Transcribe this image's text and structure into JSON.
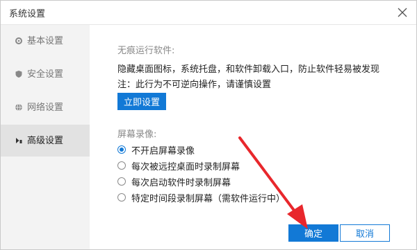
{
  "window": {
    "title": "系统设置",
    "close_icon": "close-icon"
  },
  "sidebar": {
    "items": [
      {
        "label": "基本设置",
        "icon": "gear-icon",
        "active": false
      },
      {
        "label": "安全设置",
        "icon": "shield-icon",
        "active": false
      },
      {
        "label": "网络设置",
        "icon": "globe-icon",
        "active": false
      },
      {
        "label": "高级设置",
        "icon": "advanced-icon",
        "active": true
      }
    ]
  },
  "traceless": {
    "heading": "无痕运行软件:",
    "description": "隐藏桌面图标，系统托盘，和软件卸载入口，防止软件轻易被发现",
    "note": "注：此行为不可逆向操作，请谨慎设置",
    "button_label": "立即设置"
  },
  "recording": {
    "heading": "屏幕录像:",
    "selected_index": 0,
    "options": [
      "不开启屏幕录像",
      "每次被远控桌面时录制屏幕",
      "每次启动软件时录制屏幕",
      "特定时间段录制屏幕（需软件运行中）"
    ]
  },
  "footer": {
    "ok_label": "确定",
    "cancel_label": "取消"
  },
  "colors": {
    "accent": "#1279d6",
    "annotation_arrow": "#e8272c",
    "sidebar_bg": "#f3f3f3",
    "sidebar_active_bg": "#e2e2e2"
  }
}
